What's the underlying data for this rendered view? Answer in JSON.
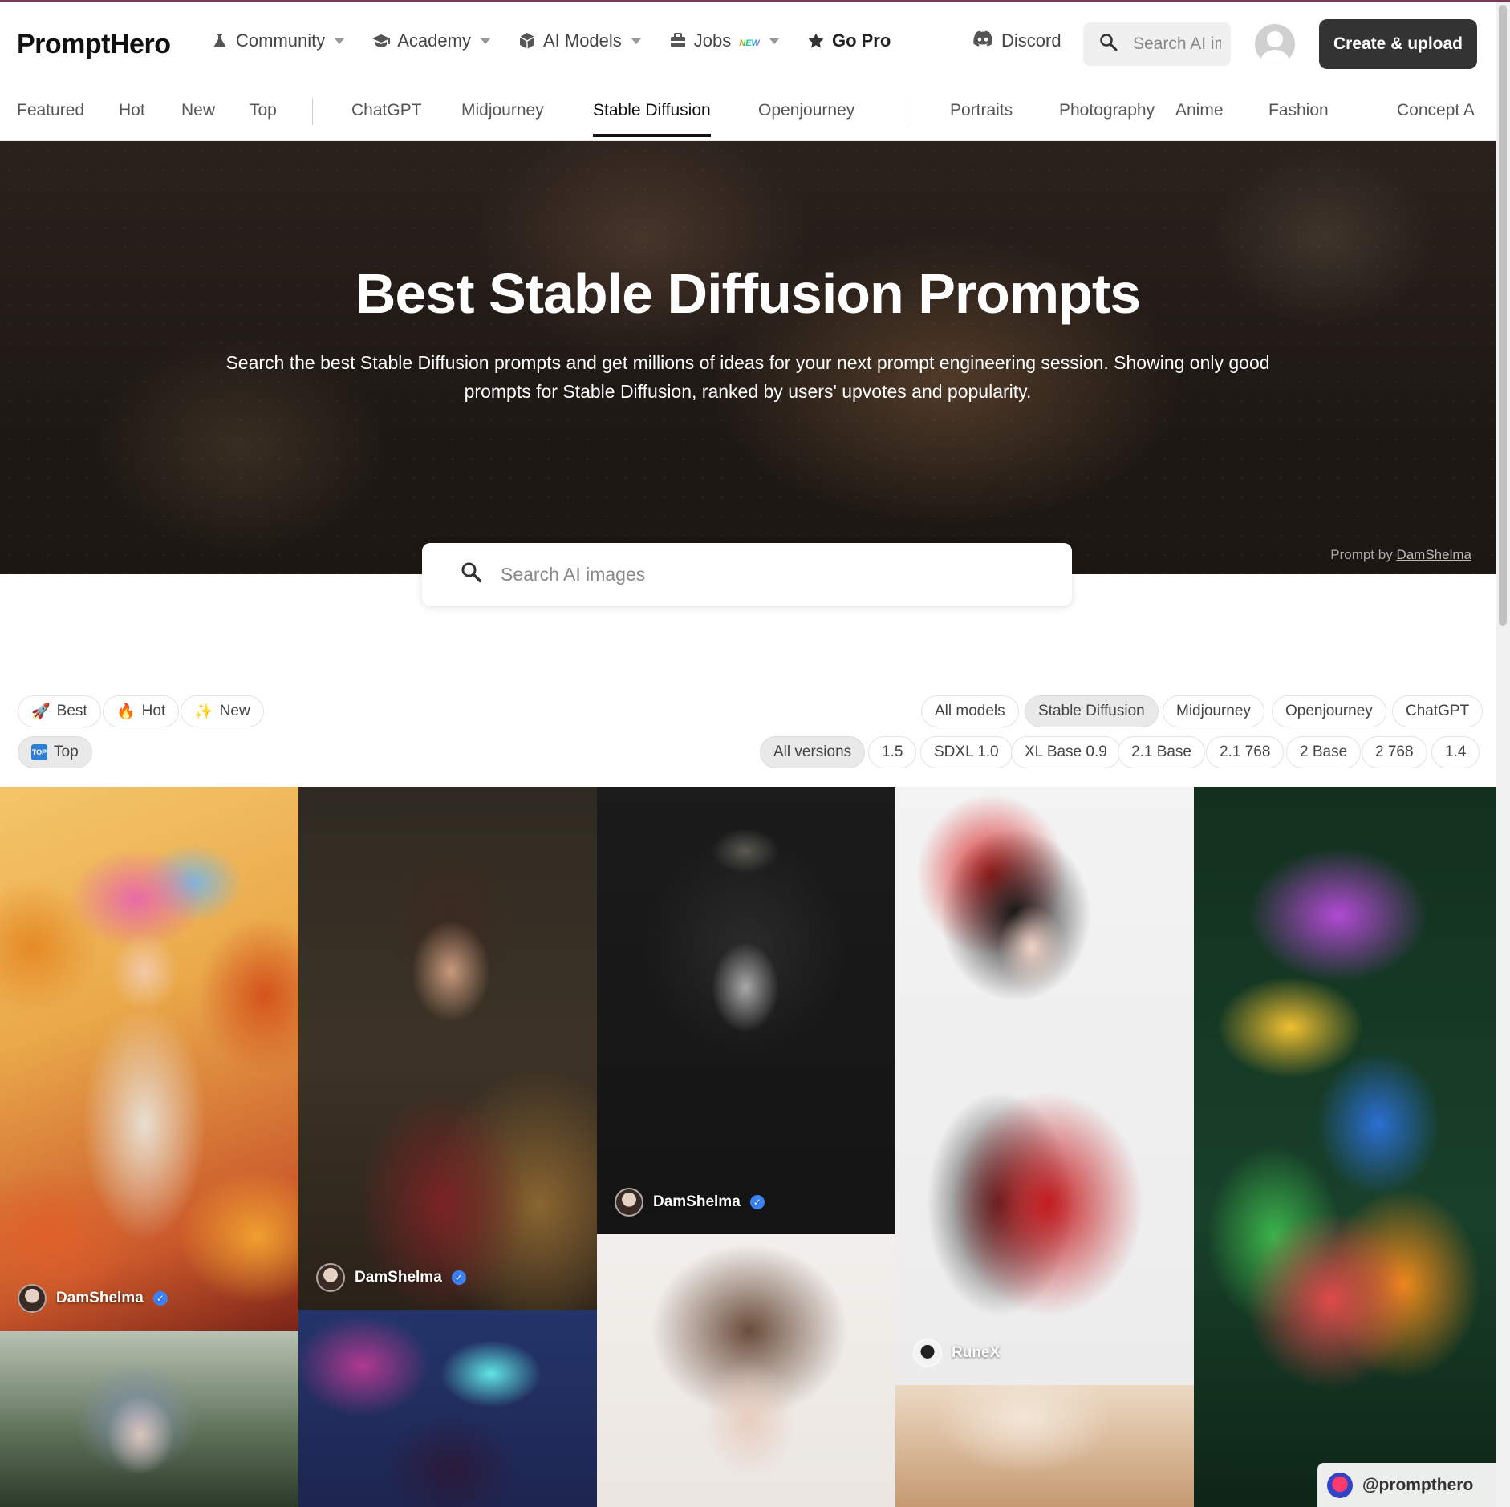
{
  "header": {
    "logo": "PromptHero",
    "nav": [
      {
        "label": "Community",
        "icon": "flask-icon"
      },
      {
        "label": "Academy",
        "icon": "graduation-cap-icon"
      },
      {
        "label": "AI Models",
        "icon": "cube-icon"
      },
      {
        "label": "Jobs",
        "icon": "briefcase-icon",
        "badge": "NEW"
      },
      {
        "label": "Go Pro",
        "icon": "star-icon"
      }
    ],
    "discord": "Discord",
    "search_placeholder": "Search AI images",
    "create_button": "Create & upload"
  },
  "categories": {
    "items": [
      "Featured",
      "Hot",
      "New",
      "Top",
      "ChatGPT",
      "Midjourney",
      "Stable Diffusion",
      "Openjourney",
      "Portraits",
      "Photography",
      "Anime",
      "Fashion",
      "Concept A"
    ],
    "active": "Stable Diffusion"
  },
  "hero": {
    "title": "Best Stable Diffusion Prompts",
    "subtitle_line1": "Search the best Stable Diffusion prompts and get millions of ideas for your next prompt engineering session. Showing only good",
    "subtitle_line2": "prompts for Stable Diffusion, ranked by users' upvotes and popularity.",
    "credit_prefix": "Prompt by",
    "credit_author": "DamShelma",
    "search_placeholder": "Search AI images"
  },
  "filters": {
    "sort": [
      {
        "label": "Best",
        "icon": "rocket-icon",
        "glyph": "🚀",
        "selected": false
      },
      {
        "label": "Hot",
        "icon": "fire-icon",
        "glyph": "🔥",
        "selected": false
      },
      {
        "label": "New",
        "icon": "sparkle-icon",
        "glyph": "✨",
        "selected": false
      },
      {
        "label": "Top",
        "icon": "top-icon",
        "glyph": "TOP",
        "selected": true
      }
    ],
    "models": [
      {
        "label": "All models",
        "selected": false
      },
      {
        "label": "Stable Diffusion",
        "selected": true
      },
      {
        "label": "Midjourney",
        "selected": false
      },
      {
        "label": "Openjourney",
        "selected": false
      },
      {
        "label": "ChatGPT",
        "selected": false
      }
    ],
    "versions": [
      {
        "label": "All versions",
        "selected": true
      },
      {
        "label": "1.5",
        "selected": false
      },
      {
        "label": "SDXL 1.0",
        "selected": false
      },
      {
        "label": "XL Base 0.9",
        "selected": false
      },
      {
        "label": "2.1 Base",
        "selected": false
      },
      {
        "label": "2.1 768",
        "selected": false
      },
      {
        "label": "2 Base",
        "selected": false
      },
      {
        "label": "2 768",
        "selected": false
      },
      {
        "label": "1.4",
        "selected": false
      }
    ]
  },
  "gallery": {
    "cards": [
      {
        "author": "DamShelma",
        "verified": true
      },
      {
        "author": "DamShelma",
        "verified": true
      },
      {
        "author": "DamShelma",
        "verified": true
      },
      {
        "author": "RuneX",
        "verified": false
      },
      {
        "author": "",
        "verified": false
      },
      {
        "author": "",
        "verified": false
      },
      {
        "author": "",
        "verified": false
      },
      {
        "author": "",
        "verified": false
      },
      {
        "author": "",
        "verified": false
      }
    ],
    "watermark": "@prompthero"
  }
}
